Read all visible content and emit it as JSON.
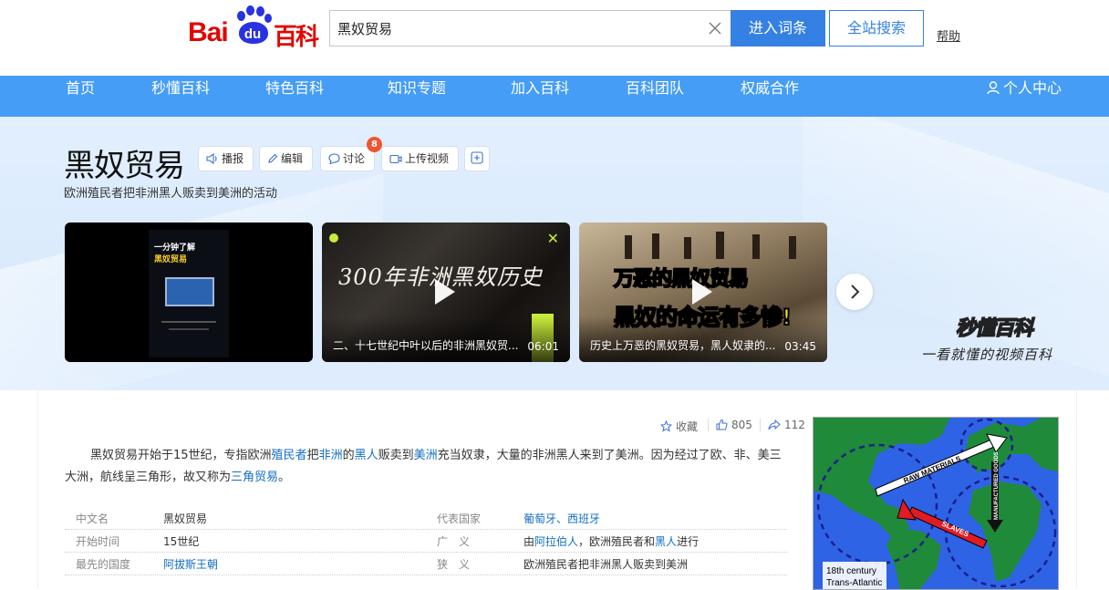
{
  "header": {
    "logo": {
      "bai": "Bai",
      "du": "du",
      "baike": "百科"
    },
    "search_value": "黑奴贸易",
    "enter_button": "进入词条",
    "all_search_button": "全站搜索",
    "help": "帮助"
  },
  "nav": {
    "items": [
      "首页",
      "秒懂百科",
      "特色百科",
      "知识专题",
      "加入百科",
      "百科团队",
      "权威合作"
    ],
    "user_center": "个人中心"
  },
  "entry": {
    "title": "黑奴贸易",
    "tools": {
      "broadcast": "播报",
      "edit": "编辑",
      "discuss": "讨论",
      "discuss_count": "8",
      "upload_video": "上传视频"
    },
    "subtitle": "欧洲殖民者把非洲黑人贩卖到美洲的活动"
  },
  "videos": [
    {
      "caption": "",
      "duration": "",
      "cover_title": "一分钟了解",
      "cover_sub": "黑奴贸易"
    },
    {
      "caption": "二、十七世纪中叶以后的非洲黑奴贸...",
      "duration": "06:01",
      "cover_title": "300年非洲黑奴历史"
    },
    {
      "caption": "历史上万恶的黑奴贸易，黑人奴隶的...",
      "duration": "03:45",
      "cover_title": "万恶的黑奴贸易",
      "cover_sub": "黑奴的命运有多惨!"
    }
  ],
  "brand": {
    "logo": "秒懂百科",
    "slogan": "一看就懂的视频百科"
  },
  "stats": {
    "collect": "收藏",
    "likes": "805",
    "shares": "112"
  },
  "summary": {
    "p1": "黑奴贸易开始于15世纪，专指欧洲",
    "link1": "殖民者",
    "p2": "把",
    "link2": "非洲",
    "p3": "的",
    "link3": "黑人",
    "p4": "贩卖到",
    "link4": "美洲",
    "p5": "充当奴隶，大量的非洲黑人来到了美洲。因为经过了欧、非、美三大洲，航线呈三角形，故又称为",
    "link5": "三角贸易",
    "p6": "。"
  },
  "info": {
    "r1": {
      "k1": "中文名",
      "v1": "黑奴贸易",
      "k2": "代表国家",
      "v2": "葡萄牙、西班牙"
    },
    "r2": {
      "k1": "开始时间",
      "v1": "15世纪",
      "k2": "广　义",
      "v2a": "由",
      "v2link1": "阿拉伯人",
      "v2b": "，欧洲殖民者和",
      "v2link2": "黑人",
      "v2c": "进行"
    },
    "r3": {
      "k1": "最先的国度",
      "v1": "阿拔斯王朝",
      "k2": "狭　义",
      "v2": "欧洲殖民者把非洲黑人贩卖到美洲"
    }
  },
  "map_image": {
    "label1": "RAW MATERIALS",
    "label2": "MANUFACTURED GOODS",
    "label3": "SLAVES",
    "caption1": "18th century",
    "caption2": "Trans-Atlantic"
  },
  "colors": {
    "nav_bg": "#459df5",
    "brand_red": "#e10601",
    "brand_blue": "#2932e1",
    "link": "#136ec2",
    "button": "#3581e3"
  }
}
